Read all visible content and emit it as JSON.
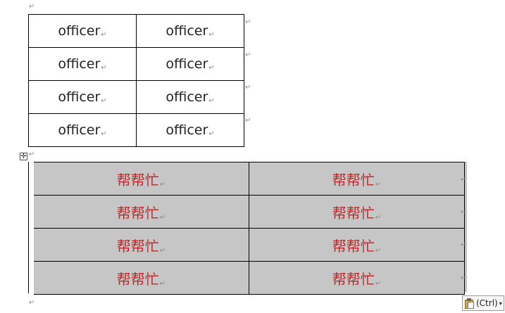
{
  "paragraph_mark": "↵",
  "table1": {
    "rows": [
      [
        "officer",
        "officer"
      ],
      [
        "officer",
        "officer"
      ],
      [
        "officer",
        "officer"
      ],
      [
        "officer",
        "officer"
      ]
    ]
  },
  "table2": {
    "rows": [
      [
        "帮帮忙",
        "帮帮忙"
      ],
      [
        "帮帮忙",
        "帮帮忙"
      ],
      [
        "帮帮忙",
        "帮帮忙"
      ],
      [
        "帮帮忙",
        "帮帮忙"
      ]
    ]
  },
  "move_handle_icon": "✛",
  "paste_options": {
    "label": "(Ctrl)",
    "caret": "▾"
  },
  "colors": {
    "table2_text": "#c0282b",
    "table2_fill": "#c6c6c6"
  }
}
